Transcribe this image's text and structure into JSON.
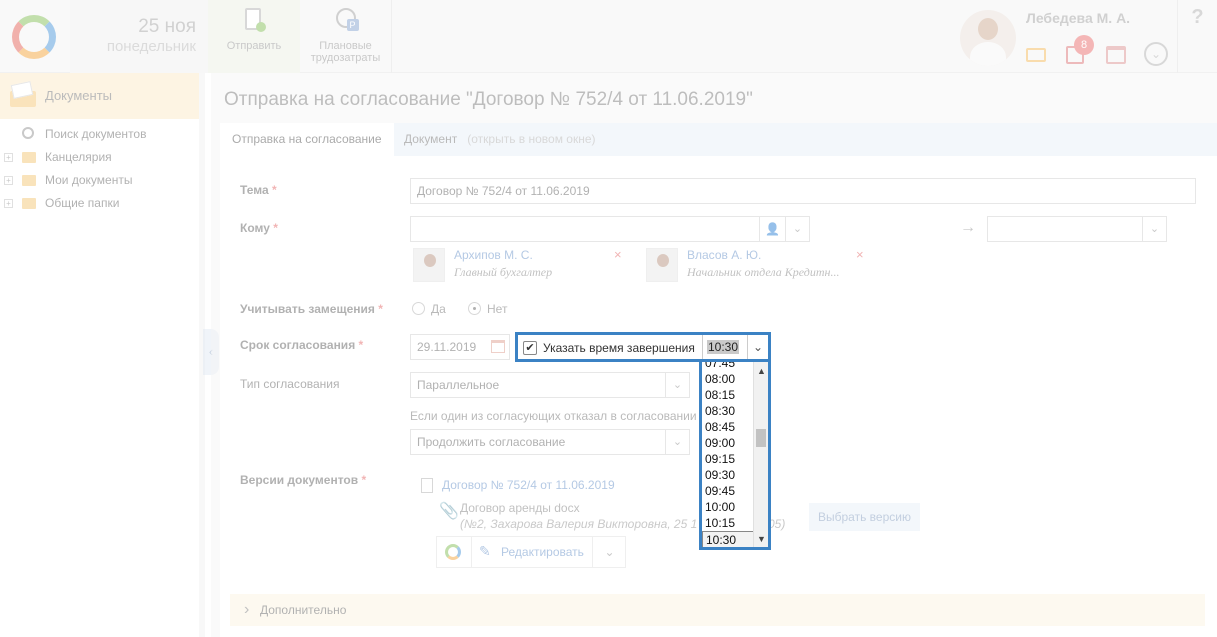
{
  "header": {
    "date_day": "25 ноя",
    "date_weekday": "понедельник",
    "send_label": "Отправить",
    "plan_label_1": "Плановые",
    "plan_label_2": "трудозатраты",
    "user_name": "Лебедева М. А.",
    "task_badge": "8",
    "help": "?"
  },
  "sidebar": {
    "title": "Документы",
    "items": [
      {
        "label": "Поиск документов"
      },
      {
        "label": "Канцелярия"
      },
      {
        "label": "Мои документы"
      },
      {
        "label": "Общие папки"
      }
    ]
  },
  "main": {
    "title": "Отправка на согласование \"Договор № 752/4 от 11.06.2019\"",
    "tabs": {
      "active": "Отправка на согласование",
      "doc": "Документ",
      "doc_link": "(открыть в новом окне)"
    },
    "form": {
      "subject_label": "Тема",
      "subject_value": "Договор № 752/4 от 11.06.2019",
      "to_label": "Кому",
      "recipients": [
        {
          "name": "Архипов М. С.",
          "role": "Главный бухгалтер"
        },
        {
          "name": "Власов А. Ю.",
          "role": "Начальник отдела Кредитн..."
        }
      ],
      "remove_mark": "×",
      "substitute_label": "Учитывать замещения",
      "yes": "Да",
      "no": "Нет",
      "deadline_label": "Срок согласования",
      "deadline_date": "29.11.2019",
      "type_label": "Тип согласования",
      "type_value": "Параллельное",
      "refuse_hint": "Если один из согласующих отказал в согласовании",
      "refuse_value": "Продолжить согласование",
      "versions_label": "Версии документов",
      "version_link": "Договор № 752/4 от 11.06.2019",
      "file_name": "Договор аренды docx",
      "file_meta": "(№2, Захарова Валерия Викторовна, 25 1",
      "file_meta_tail": "05)",
      "choose_version": "Выбрать версию",
      "edit_label": "Редактировать",
      "more_label": "Дополнительно"
    }
  },
  "time_picker": {
    "checkbox_label": "Указать время завершения",
    "checked": true,
    "value": "10:30",
    "options": [
      "07:45",
      "08:00",
      "08:15",
      "08:30",
      "08:45",
      "09:00",
      "09:15",
      "09:30",
      "09:45",
      "10:00",
      "10:15",
      "10:30"
    ],
    "selected": "10:30"
  },
  "colors": {
    "accent": "#3b82c4",
    "required": "#e25a5a",
    "link": "#5a88c4"
  }
}
